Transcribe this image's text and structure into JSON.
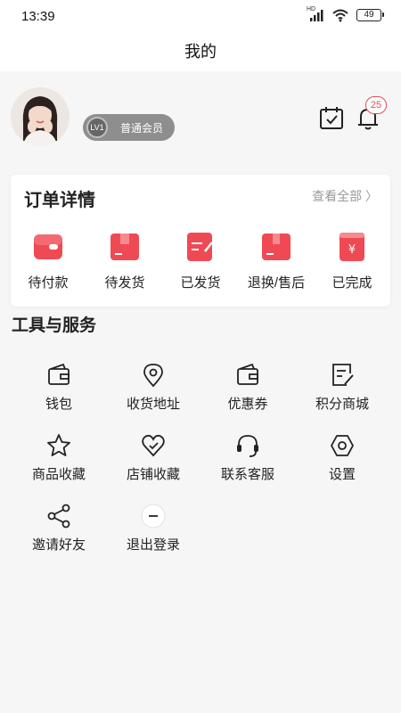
{
  "status_bar": {
    "time": "13:39",
    "signal_label": "HD",
    "battery": "49"
  },
  "title": "我的",
  "profile": {
    "member_level": "LV1",
    "member_text": "普通会员",
    "notification_count": "25"
  },
  "orders": {
    "title": "订单详情",
    "see_all": "查看全部 〉",
    "items": [
      {
        "label": "待付款",
        "icon": "wallet-icon"
      },
      {
        "label": "待发货",
        "icon": "package-icon"
      },
      {
        "label": "已发货",
        "icon": "shipped-note-icon"
      },
      {
        "label": "退换/售后",
        "icon": "return-box-icon"
      },
      {
        "label": "已完成",
        "icon": "yuan-receipt-icon"
      }
    ],
    "accent": "#ef4a54"
  },
  "tools": {
    "title": "工具与服务",
    "items": [
      {
        "label": "钱包",
        "icon": "wallet-icon"
      },
      {
        "label": "收货地址",
        "icon": "location-pin-icon"
      },
      {
        "label": "优惠券",
        "icon": "coupon-icon"
      },
      {
        "label": "积分商城",
        "icon": "edit-document-icon"
      },
      {
        "label": "商品收藏",
        "icon": "star-icon"
      },
      {
        "label": "店铺收藏",
        "icon": "heart-icon"
      },
      {
        "label": "联系客服",
        "icon": "headset-icon"
      },
      {
        "label": "设置",
        "icon": "settings-hexagon-icon"
      },
      {
        "label": "邀请好友",
        "icon": "share-icon"
      },
      {
        "label": "退出登录",
        "icon": "minus-circle-icon"
      }
    ]
  }
}
